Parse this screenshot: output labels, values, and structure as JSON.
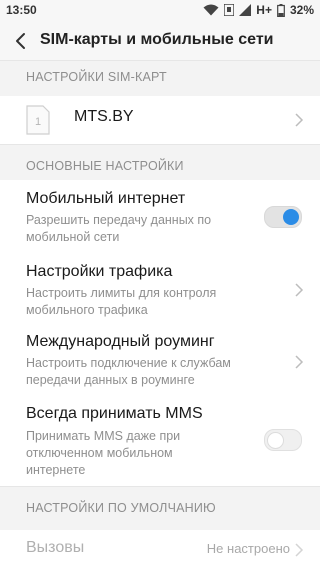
{
  "status": {
    "time": "13:50",
    "network": "H+",
    "battery": "32%"
  },
  "header": {
    "title": "SIM-карты и мобильные сети"
  },
  "sim_section": {
    "title": "НАСТРОЙКИ SIM-КАРТ",
    "sim": {
      "slot": "1",
      "operator": "MTS.BY"
    }
  },
  "general_section": {
    "title": "ОСНОВНЫЕ НАСТРОЙКИ",
    "mobile_internet": {
      "title": "Мобильный интернет",
      "subtitle": "Разрешить передачу данных по мобильной сети",
      "enabled": true
    },
    "traffic": {
      "title": "Настройки трафика",
      "subtitle": "Настроить лимиты для контроля мобильного трафика"
    },
    "roaming": {
      "title": "Международный роуминг",
      "subtitle": "Настроить подключение к службам передачи данных в роуминге"
    },
    "mms": {
      "title": "Всегда принимать MMS",
      "subtitle": "Принимать MMS даже при отключенном мобильном интернете",
      "enabled": false
    }
  },
  "default_section": {
    "title": "НАСТРОЙКИ ПО УМОЛЧАНИЮ",
    "calls": {
      "title": "Вызовы",
      "value": "Не настроено"
    }
  },
  "colors": {
    "accent": "#2b8ce6",
    "background": "#f7f7f7",
    "card": "#ffffff",
    "muted": "#8f8f8f"
  },
  "icons": [
    "wifi-icon",
    "sim-signal-icon",
    "battery-icon",
    "back-arrow-icon",
    "sim-card-icon",
    "chevron-right-icon"
  ]
}
